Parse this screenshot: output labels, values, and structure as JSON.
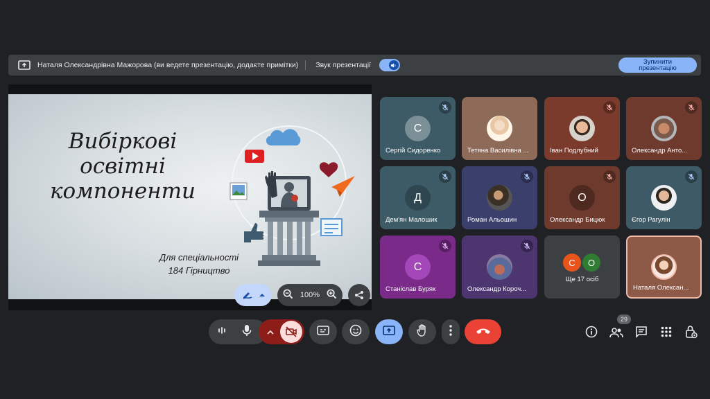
{
  "presentation_bar": {
    "presenter_text": "Наталя Олександрівна Мажорова (ви ведете презентацію, додаєте примітки)",
    "sound_label": "Звук презентації",
    "stop_button_label": "Зупинити презентацію"
  },
  "slide": {
    "title_lines": [
      "Вибіркові",
      "освітні",
      "компоненти"
    ],
    "subtitle_lines": [
      "Для спеціальності",
      "184 Гірництво"
    ]
  },
  "slide_tools": {
    "zoom_level": "100%"
  },
  "participants": [
    {
      "name": "Сергій Сидоренко",
      "initial": "С",
      "color": "#3d5b66",
      "muted": true
    },
    {
      "name": "Тетяна Василівна ...",
      "initial": "",
      "color": "#8e6a58",
      "muted": false
    },
    {
      "name": "Іван Подлубний",
      "initial": "",
      "color": "#7a3b2c",
      "muted": true
    },
    {
      "name": "Олександр Анто...",
      "initial": "",
      "color": "#6e3a2d",
      "muted": true
    },
    {
      "name": "Дем'ян Малошик",
      "initial": "Д",
      "color": "#3d5b66",
      "muted": true
    },
    {
      "name": "Роман Альошин",
      "initial": "",
      "color": "#3b3f6b",
      "muted": true
    },
    {
      "name": "Олександр Бицюк",
      "initial": "О",
      "color": "#6e3a2d",
      "muted": true
    },
    {
      "name": "Єгор Рагулін",
      "initial": "",
      "color": "#3e5a66",
      "muted": true
    },
    {
      "name": "Станіслав Буряк",
      "initial": "С",
      "color": "#7a2b8a",
      "muted": true
    },
    {
      "name": "Олександр Короч...",
      "initial": "",
      "color": "#4d3670",
      "muted": true
    }
  ],
  "others_tile": {
    "label": "Ще 17 осіб",
    "initials": [
      "С",
      "О"
    ],
    "colors": [
      "#e8541c",
      "#2e7d32"
    ]
  },
  "self_tile": {
    "name": "Наталя Олексан..."
  },
  "people_count": "29"
}
